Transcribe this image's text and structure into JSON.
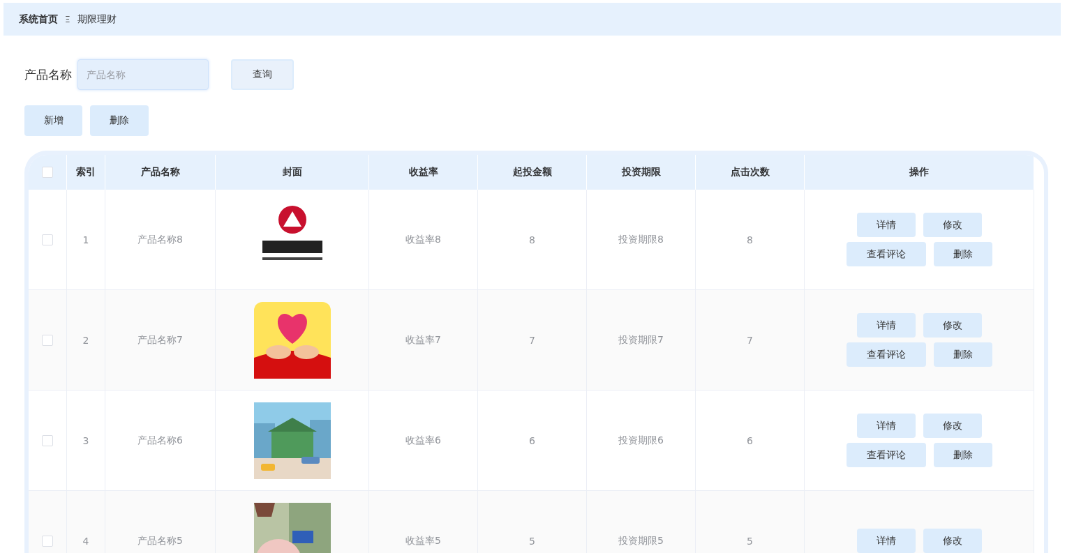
{
  "breadcrumb": {
    "items": [
      {
        "label": "系统首页",
        "selected": false
      },
      {
        "label": "期限理财",
        "selected": true
      }
    ],
    "separator": "Ξ"
  },
  "search": {
    "label": "产品名称",
    "placeholder": "产品名称",
    "button": "查询"
  },
  "actions": [
    "新增",
    "删除"
  ],
  "table": {
    "select_all_checked": false,
    "columns": [
      "索引",
      "产品名称",
      "封面",
      "收益率",
      "起投金额",
      "投资期限",
      "点击次数",
      "操作"
    ],
    "rows": [
      {
        "checked": false,
        "index": "1",
        "name": "产品名称8",
        "rate": "收益率8",
        "min": "8",
        "term": "投资期限8",
        "clicks": "8",
        "buttons": [
          "详情",
          "修改",
          "查看评论",
          "删除"
        ]
      },
      {
        "checked": false,
        "index": "2",
        "name": "产品名称7",
        "rate": "收益率7",
        "min": "7",
        "term": "投资期限7",
        "clicks": "7",
        "buttons": [
          "详情",
          "修改",
          "查看评论",
          "删除"
        ]
      },
      {
        "checked": false,
        "index": "3",
        "name": "产品名称6",
        "rate": "收益率6",
        "min": "6",
        "term": "投资期限6",
        "clicks": "6",
        "buttons": [
          "详情",
          "修改",
          "查看评论",
          "删除"
        ]
      },
      {
        "checked": false,
        "index": "4",
        "name": "产品名称5",
        "rate": "收益率5",
        "min": "5",
        "term": "投资期限5",
        "clicks": "5",
        "buttons": [
          "详情",
          "修改"
        ]
      }
    ]
  }
}
